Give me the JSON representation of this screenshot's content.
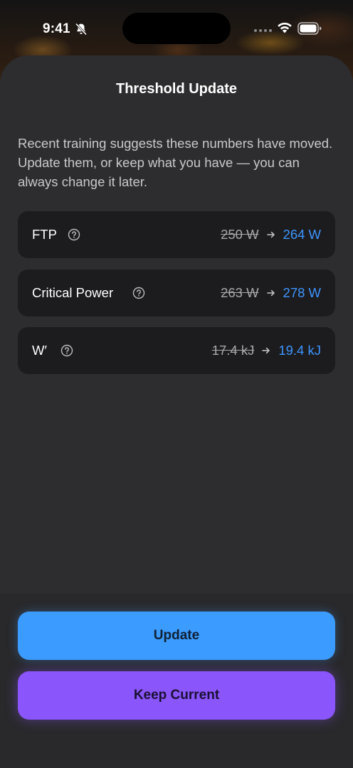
{
  "status_bar": {
    "time": "9:41",
    "icons": [
      "bell-off-icon",
      "signal-icon",
      "wifi-icon",
      "battery-icon"
    ]
  },
  "sheet": {
    "title": "Threshold Update",
    "description": "Recent training suggests these numbers have moved. Update them, or keep what you have — you can always change it later.",
    "metrics": [
      {
        "name": "FTP",
        "old_value": "250 W",
        "new_value": "264 W",
        "icon": "help-icon"
      },
      {
        "name": "Critical Power",
        "old_value": "263 W",
        "new_value": "278 W",
        "icon": "help-icon"
      },
      {
        "name": "W′",
        "old_value": "17.4 kJ",
        "new_value": "19.4 kJ",
        "icon": "help-icon"
      }
    ]
  },
  "actions": {
    "update_label": "Update",
    "keep_label": "Keep Current"
  },
  "colors": {
    "accent_blue": "#3b9bff",
    "accent_purple": "#8a55fb",
    "new_value": "#3d95ff",
    "sheet_bg": "#2d2d2f",
    "row_bg": "#1c1c1e"
  }
}
